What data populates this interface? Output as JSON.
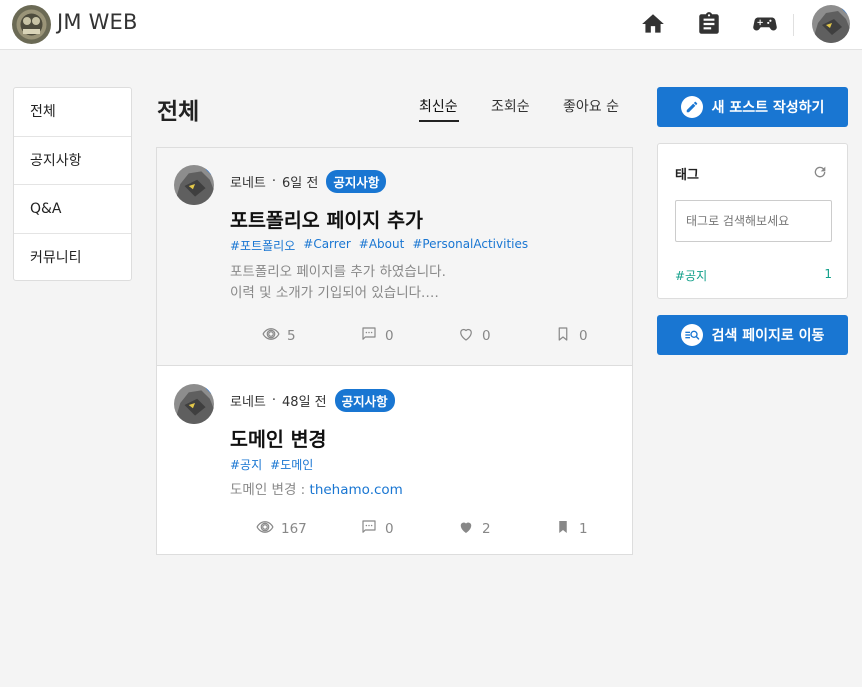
{
  "header": {
    "brand": "JM WEB",
    "icons": [
      "home-icon",
      "clipboard-icon",
      "gamepad-icon"
    ],
    "accent": "#1976d2"
  },
  "leftnav": {
    "items": [
      {
        "label": "전체"
      },
      {
        "label": "공지사항"
      },
      {
        "label": "Q&A"
      },
      {
        "label": "커뮤니티"
      }
    ]
  },
  "main": {
    "title": "전체",
    "sort": [
      {
        "label": "최신순",
        "active": true
      },
      {
        "label": "조회순",
        "active": false
      },
      {
        "label": "좋아요 순",
        "active": false
      }
    ],
    "posts": [
      {
        "author": "로네트",
        "dot": "·",
        "time": "6일 전",
        "category": "공지사항",
        "title": "포트폴리오 페이지 추가",
        "tags": [
          "#포트폴리오",
          "#Carrer",
          "#About",
          "#PersonalActivities"
        ],
        "excerpt_line1": "포트폴리오 페이지를 추가 하였습니다.",
        "excerpt_line2": "이력 및 소개가 기입되어 있습니다.…",
        "views": "5",
        "comments": "0",
        "likes": "0",
        "bookmarks": "0",
        "liked": false,
        "bookmarked": false
      },
      {
        "author": "로네트",
        "dot": "·",
        "time": "48일 전",
        "category": "공지사항",
        "title": "도메인 변경",
        "tags": [
          "#공지",
          "#도메인"
        ],
        "excerpt_prefix": "도메인 변경 : ",
        "excerpt_link": "thehamo.com",
        "views": "167",
        "comments": "0",
        "likes": "2",
        "bookmarks": "1",
        "liked": true,
        "bookmarked": true
      }
    ]
  },
  "sidebar": {
    "new_post_label": "새 포스트 작성하기",
    "tag_panel": {
      "title": "태그",
      "search_placeholder": "태그로 검색해보세요",
      "tags": [
        {
          "name": "#공지",
          "count": "1"
        }
      ]
    },
    "search_page_label": "검색 페이지로 이동"
  }
}
